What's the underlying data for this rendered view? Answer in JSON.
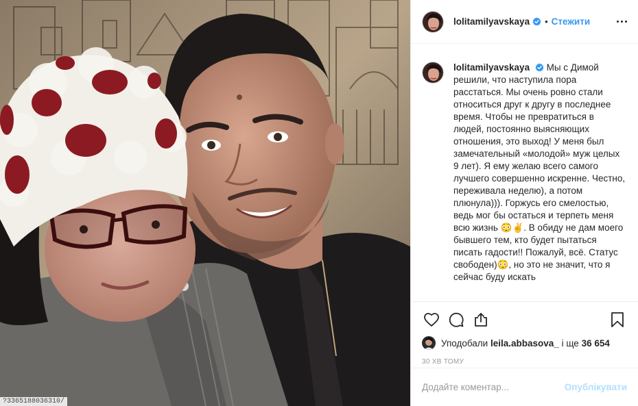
{
  "photo": {
    "overlay_id": "?3365188036310/"
  },
  "post": {
    "username": "lolitamilyavskaya",
    "verified": true,
    "separator": "•",
    "follow_label": "Стежити",
    "caption": "Мы с Димой решили, что наступила пора расстаться. Мы очень ровно стали относиться друг к другу в последнее время. Чтобы не превратиться в людей, постоянно выясняющих отношения, это выход! У меня был замечательный «молодой» муж целых 9 лет). Я ему желаю всего самого лучшего совершенно искренне. Честно, переживала неделю), а потом плюнула))). Горжусь его смелостью, ведь мог бы остаться и терпеть меня всю жизнь 😳✌️. В обиду не дам моего бывшего тем, кто будет пытаться писать гадости!! Пожалуй, всё. Статус свободен)😳, но это не значит, что я сейчас буду искать",
    "likes_prefix": "Уподобали",
    "likes_user": "leila.abbasova_",
    "likes_middle": "і ще",
    "likes_count": "36 654",
    "timestamp": "30 хв тому"
  },
  "comment_box": {
    "placeholder": "Додайте коментар...",
    "publish_label": "Опублікувати"
  },
  "icons": {
    "more": "more-icon",
    "verified": "verified-badge-icon",
    "like": "heart-icon",
    "comment": "comment-icon",
    "share": "share-icon",
    "save": "bookmark-icon"
  },
  "colors": {
    "link": "#3897f0",
    "verified": "#3897f0",
    "publish_disabled": "#b2dffc",
    "muted": "#999999",
    "text": "#262626",
    "border": "#efefef"
  }
}
